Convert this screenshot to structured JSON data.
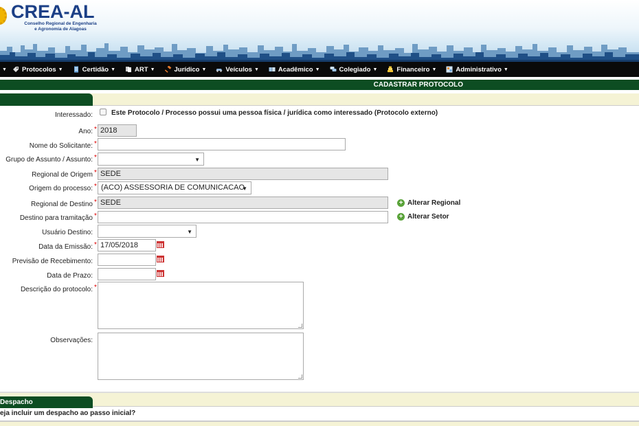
{
  "brand": {
    "title": "CREA-AL",
    "subtitle_line1": "Conselho Regional de Engenharia",
    "subtitle_line2": "e Agronomia de Alagoas"
  },
  "nav": {
    "items": [
      {
        "label": "Protocolos",
        "icon": "tag-icon"
      },
      {
        "label": "Certidão",
        "icon": "document-icon"
      },
      {
        "label": "ART",
        "icon": "files-icon"
      },
      {
        "label": "Jurídico",
        "icon": "gavel-icon"
      },
      {
        "label": "Veículos",
        "icon": "car-icon"
      },
      {
        "label": "Acadêmico",
        "icon": "book-icon"
      },
      {
        "label": "Colegiado",
        "icon": "chat-icon"
      },
      {
        "label": "Financeiro",
        "icon": "coins-icon"
      },
      {
        "label": "Administrativo",
        "icon": "admin-icon"
      }
    ]
  },
  "page_title": "CADASTRAR PROTOCOLO",
  "form": {
    "interessado_label": "Interessado:",
    "interessado_checkbox_text": "Este Protocolo / Processo possui uma pessoa física / jurídica como interessado (Protocolo externo)",
    "ano_label": "Ano:",
    "ano_value": "2018",
    "nome_label": "Nome do Solicitante:",
    "nome_value": "",
    "grupo_label": "Grupo de Assunto / Assunto:",
    "grupo_value": "",
    "regional_origem_label": "Regional de Origem",
    "regional_origem_value": "SEDE",
    "origem_label": "Origem do processo:",
    "origem_value": "(ACO) ASSESSORIA DE COMUNICACAO",
    "regional_destino_label": "Regional de Destino",
    "regional_destino_value": "SEDE",
    "alterar_regional": "Alterar Regional",
    "destino_label": "Destino para tramitação",
    "destino_value": "",
    "alterar_setor": "Alterar Setor",
    "usuario_label": "Usuário Destino:",
    "usuario_value": "",
    "data_emissao_label": "Data da Emissão:",
    "data_emissao_value": "17/05/2018",
    "previsao_label": "Previsão de Recebimento:",
    "previsao_value": "",
    "prazo_label": "Data de Prazo:",
    "prazo_value": "",
    "descricao_label": "Descrição do protocolo:",
    "observacoes_label": "Observações:"
  },
  "despacho": {
    "tab_label": "Despacho",
    "question": "eja incluir um despacho ao passo inicial?"
  },
  "colors": {
    "nav_bg": "#0a0a0a",
    "section_green": "#0d4d22",
    "strip_bg": "#f5f3d5",
    "brand_blue": "#1b3f86",
    "required_red": "#dd0000"
  }
}
